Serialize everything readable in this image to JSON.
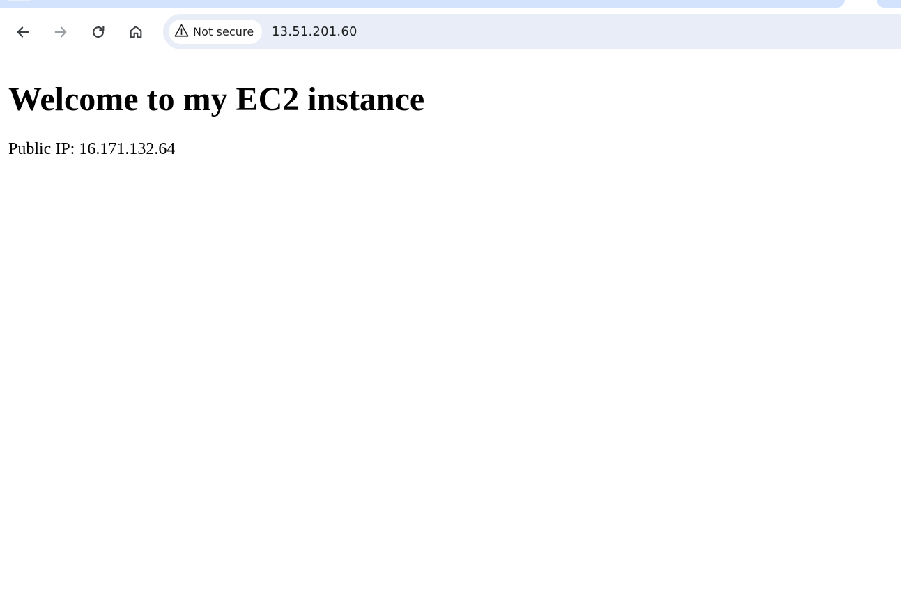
{
  "browser": {
    "security_chip": {
      "icon": "warning-triangle-icon",
      "label": "Not secure"
    },
    "address_bar": {
      "url": "13.51.201.60"
    },
    "nav": {
      "back_icon": "arrow-left-icon",
      "forward_icon": "arrow-right-icon",
      "reload_icon": "reload-icon",
      "home_icon": "home-icon"
    },
    "colors": {
      "tab_active": "#d3e3fd",
      "omnibox": "#e9edf7",
      "forward_disabled": "#9aa0a6"
    }
  },
  "page": {
    "heading": "Welcome to my EC2 instance",
    "public_ip_text": "Public IP: 16.171.132.64"
  }
}
